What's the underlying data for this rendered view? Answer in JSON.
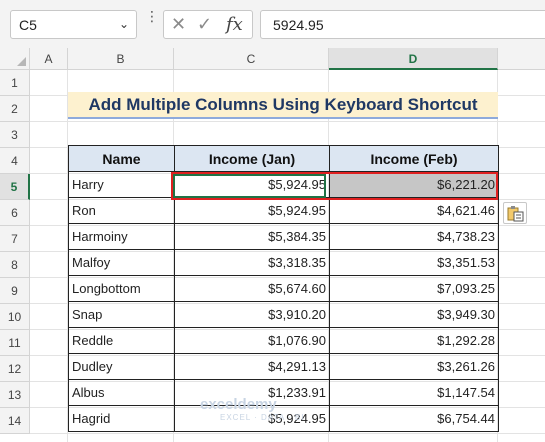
{
  "name_box": "C5",
  "formula_value": "5924.95",
  "columns": [
    "A",
    "B",
    "C",
    "D"
  ],
  "selected_column": "D",
  "rows": [
    "1",
    "2",
    "3",
    "4",
    "5",
    "6",
    "7",
    "8",
    "9",
    "10",
    "11",
    "12",
    "13",
    "14"
  ],
  "selected_row": "5",
  "title": "Add Multiple Columns Using Keyboard Shortcut",
  "table": {
    "headers": [
      "Name",
      "Income (Jan)",
      "Income (Feb)"
    ],
    "rows": [
      {
        "name": "Harry",
        "jan": "$5,924.95",
        "feb": "$6,221.20"
      },
      {
        "name": "Ron",
        "jan": "$5,924.95",
        "feb": "$4,621.46"
      },
      {
        "name": "Harmoiny",
        "jan": "$5,384.35",
        "feb": "$4,738.23"
      },
      {
        "name": "Malfoy",
        "jan": "$3,318.35",
        "feb": "$3,351.53"
      },
      {
        "name": "Longbottom",
        "jan": "$5,674.60",
        "feb": "$7,093.25"
      },
      {
        "name": "Snap",
        "jan": "$3,910.20",
        "feb": "$3,949.30"
      },
      {
        "name": "Reddle",
        "jan": "$1,076.90",
        "feb": "$1,292.28"
      },
      {
        "name": "Dudley",
        "jan": "$4,291.13",
        "feb": "$3,261.26"
      },
      {
        "name": "Albus",
        "jan": "$1,233.91",
        "feb": "$1,147.54"
      },
      {
        "name": "Hagrid",
        "jan": "$5,924.95",
        "feb": "$6,754.44"
      }
    ]
  },
  "watermark": {
    "brand": "exceldemy",
    "tagline": "EXCEL · DATA · BI"
  },
  "colors": {
    "accent": "#217346",
    "highlight_border": "#e02020",
    "header_fill": "#dce6f2",
    "title_fill": "#fdf1cf"
  }
}
